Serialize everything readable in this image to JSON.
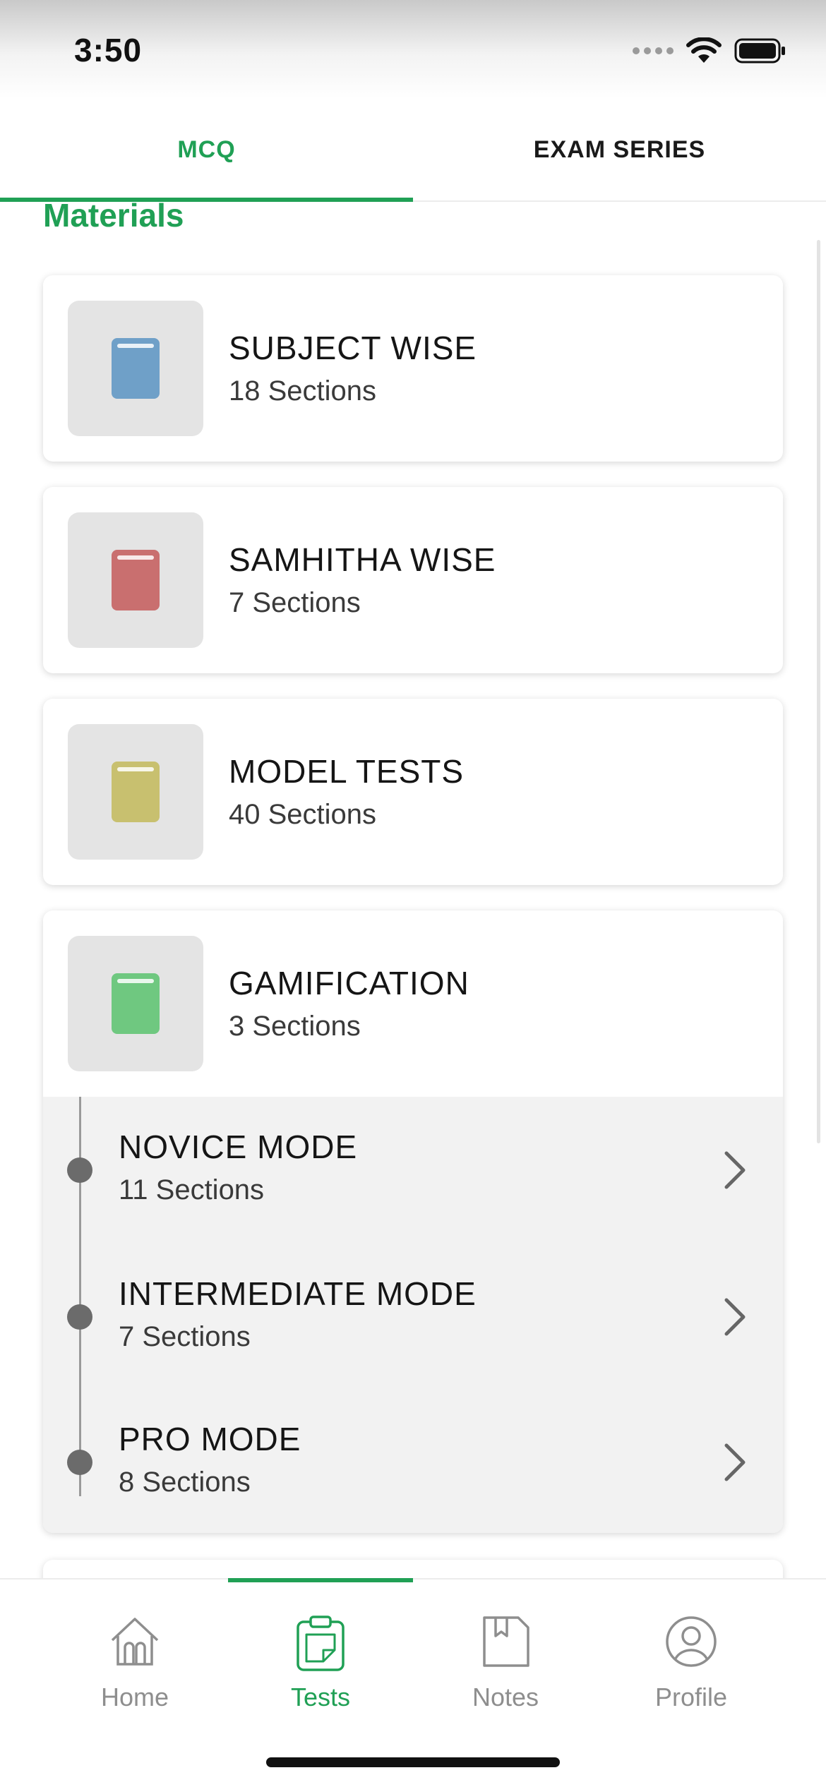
{
  "status_bar": {
    "time": "3:50"
  },
  "top_tabs": [
    {
      "label": "MCQ",
      "active": true
    },
    {
      "label": "EXAM SERIES",
      "active": false
    }
  ],
  "section_title": "Materials",
  "cards": [
    {
      "title": "SUBJECT WISE",
      "subtitle": "18 Sections",
      "icon": "book-icon",
      "icon_color": "#6fa0c8"
    },
    {
      "title": "SAMHITHA WISE",
      "subtitle": "7 Sections",
      "icon": "book-icon",
      "icon_color": "#c96f6f"
    },
    {
      "title": "MODEL TESTS",
      "subtitle": "40 Sections",
      "icon": "book-icon",
      "icon_color": "#c8c06f"
    },
    {
      "title": "GAMIFICATION",
      "subtitle": "3 Sections",
      "icon": "book-icon",
      "icon_color": "#6fc880"
    }
  ],
  "gamification_modes": [
    {
      "title": "NOVICE MODE",
      "subtitle": "11 Sections"
    },
    {
      "title": "INTERMEDIATE MODE",
      "subtitle": "7 Sections"
    },
    {
      "title": "PRO MODE",
      "subtitle": "8 Sections"
    }
  ],
  "bottom_nav": [
    {
      "label": "Home",
      "icon": "home-icon",
      "active": false
    },
    {
      "label": "Tests",
      "icon": "clipboard-icon",
      "active": true
    },
    {
      "label": "Notes",
      "icon": "bookmark-note-icon",
      "active": false
    },
    {
      "label": "Profile",
      "icon": "user-circle-icon",
      "active": false
    }
  ],
  "colors": {
    "accent": "#20a055"
  }
}
